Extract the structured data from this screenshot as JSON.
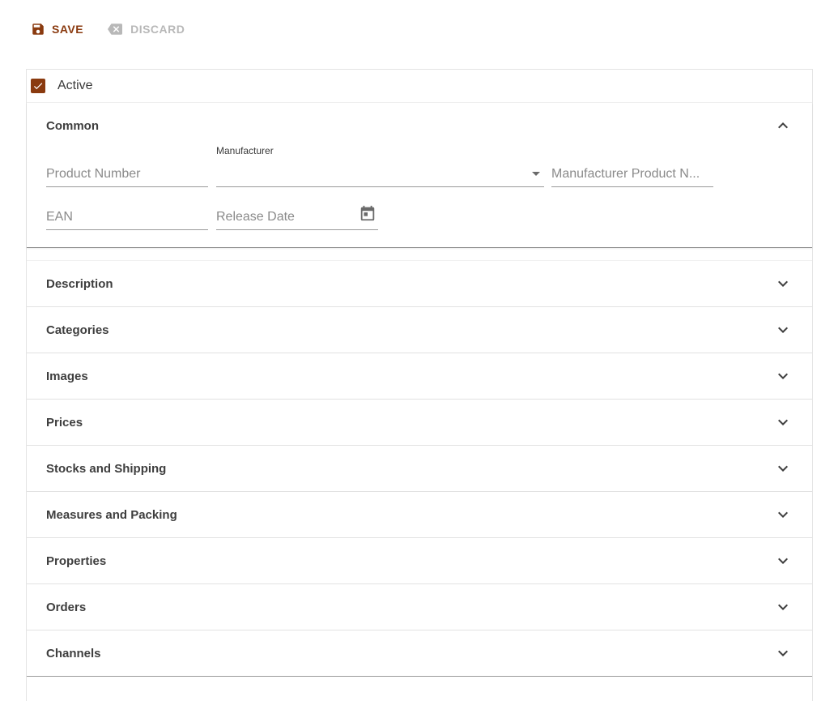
{
  "toolbar": {
    "save_label": "SAVE",
    "discard_label": "DISCARD"
  },
  "active": {
    "label": "Active",
    "checked": true
  },
  "common": {
    "title": "Common",
    "fields": {
      "product_number": "Product Number",
      "manufacturer_label": "Manufacturer",
      "manufacturer_product_number": "Manufacturer Product N...",
      "ean": "EAN",
      "release_date": "Release Date"
    }
  },
  "sections": [
    {
      "title": "Description"
    },
    {
      "title": "Categories"
    },
    {
      "title": "Images"
    },
    {
      "title": "Prices"
    },
    {
      "title": "Stocks and Shipping"
    },
    {
      "title": "Measures and Packing"
    },
    {
      "title": "Properties"
    },
    {
      "title": "Orders"
    },
    {
      "title": "Channels"
    }
  ],
  "colors": {
    "accent": "#8a3a0f",
    "disabled": "#b8b8b8"
  },
  "icons": {
    "save": "save-icon",
    "discard": "backspace-icon",
    "expand": "chevron-down-icon",
    "collapse": "chevron-up-icon",
    "calendar": "calendar-icon",
    "dropdown": "dropdown-arrow-icon"
  }
}
